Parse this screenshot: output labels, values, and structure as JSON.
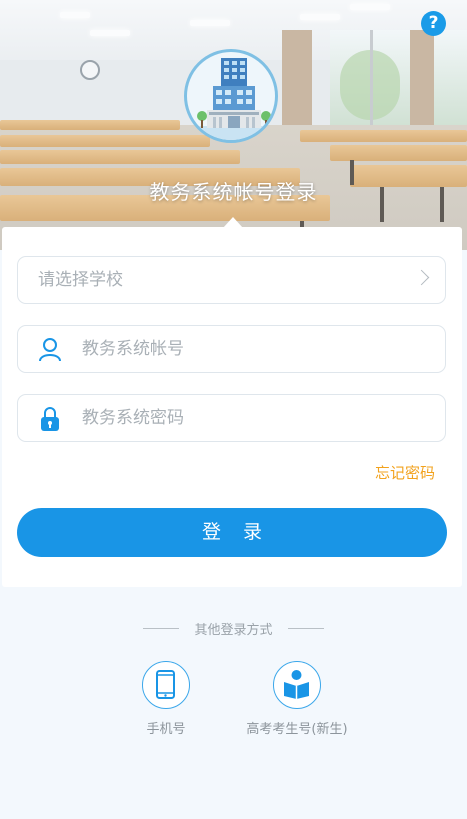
{
  "hero": {
    "title": "教务系统帐号登录"
  },
  "help": {
    "label": "?"
  },
  "form": {
    "school": {
      "placeholder": "请选择学校"
    },
    "account": {
      "placeholder": "教务系统帐号"
    },
    "password": {
      "placeholder": "教务系统密码"
    },
    "forgot_label": "忘记密码",
    "login_label": "登录"
  },
  "other_login": {
    "title": "其他登录方式",
    "options": [
      {
        "label": "手机号",
        "icon": "phone-icon"
      },
      {
        "label": "高考考生号(新生)",
        "icon": "book-reader-icon"
      }
    ]
  },
  "colors": {
    "primary": "#1995e6",
    "forgot": "#f2a21d",
    "placeholder": "#a9b0b6"
  }
}
